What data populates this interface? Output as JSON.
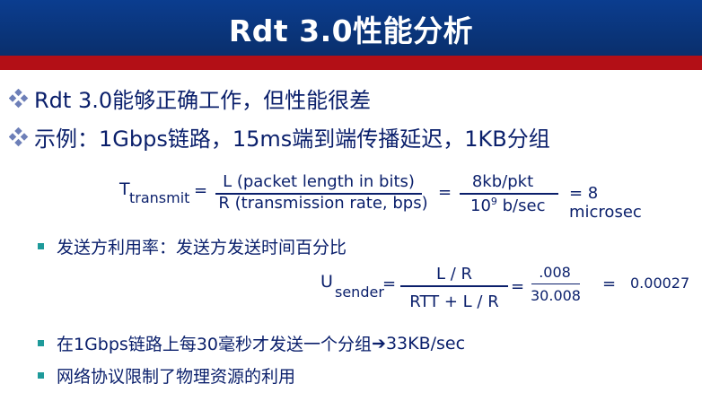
{
  "slide": {
    "title": "Rdt 3.0性能分析",
    "bullets": [
      "Rdt 3.0能够正确工作，但性能很差",
      "示例：1Gbps链路，15ms端到端传播延迟，1KB分组"
    ],
    "formula1": {
      "lhs_main": "T",
      "lhs_sub": "transmit",
      "eq1": "=",
      "numerator": "L (packet length in bits)",
      "denominator": "R (transmission rate, bps)",
      "eq2": "=",
      "num2": "8kb/pkt",
      "den2_base": "10",
      "den2_exp": "9",
      "den2_rest": " b/sec",
      "result": "= 8 microsec"
    },
    "sub_bullets": [
      "发送方利用率：发送方发送时间百分比",
      "在1Gbps链路上每30毫秒才发送一个分组",
      "网络协议限制了物理资源的利用"
    ],
    "arrow_text": "33KB/sec",
    "formula2": {
      "lhs_main": "U",
      "lhs_sub": "sender",
      "eq1": "=",
      "numerator": "L / R",
      "denominator": "RTT + L / R",
      "eq2": "=",
      "num2": ".008",
      "den2": "30.008",
      "eq3": "=",
      "result": "0.00027"
    }
  },
  "colors": {
    "title_bg": "#0b3d8f",
    "accent_red": "#b30f16",
    "text": "#0a1f6b",
    "bullet_teal": "#1e9a9a"
  }
}
